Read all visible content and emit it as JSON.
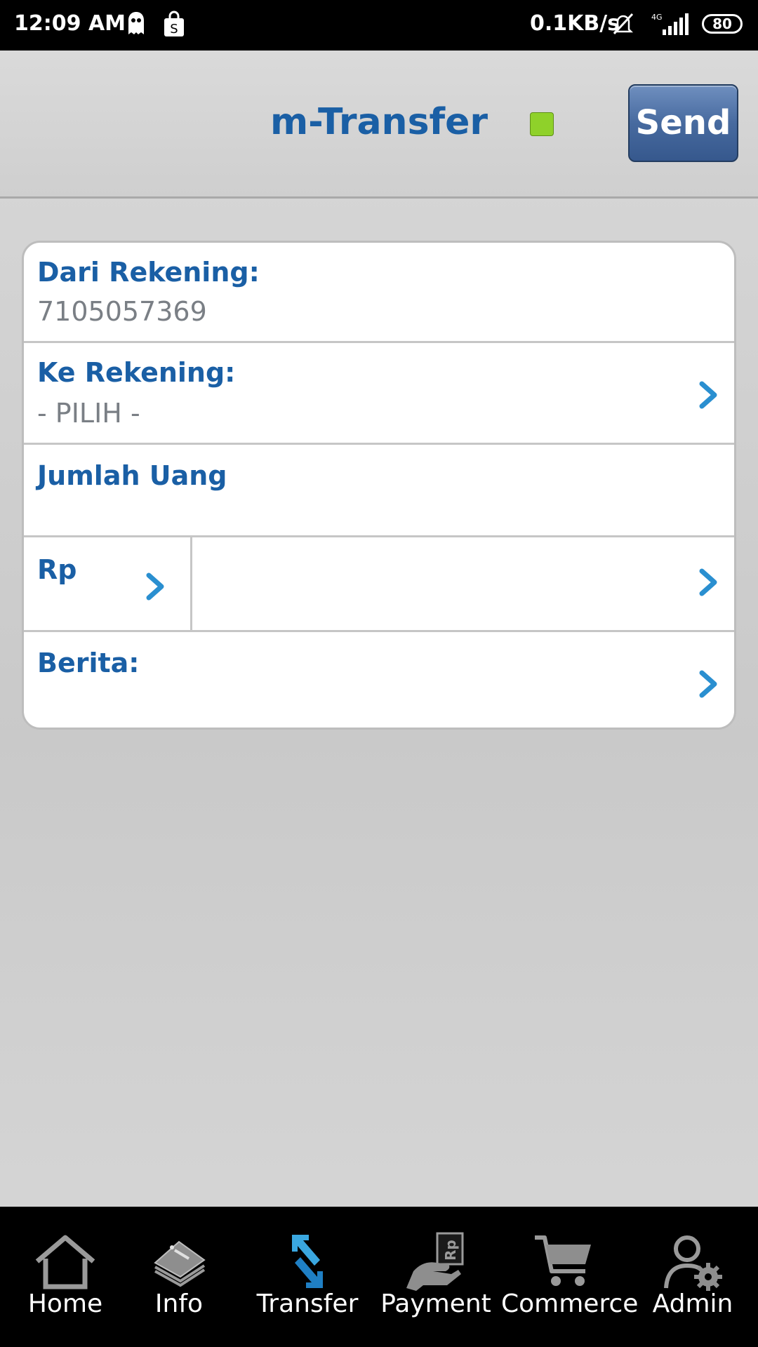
{
  "status_bar": {
    "time": "12:09 AM",
    "net_speed": "0.1KB/s",
    "network": "4G",
    "battery": "80",
    "icons": [
      "ghost-notification-icon",
      "shopping-bag-icon",
      "mute-icon",
      "signal-icon",
      "battery-icon"
    ]
  },
  "header": {
    "title": "m-Transfer",
    "status_color": "#8fd12a",
    "send_label": "Send"
  },
  "form": {
    "from_label": "Dari Rekening:",
    "from_value": "7105057369",
    "to_label": "Ke Rekening:",
    "to_value": "- PILIH -",
    "amount_label": "Jumlah Uang",
    "currency_label": "Rp",
    "amount_value": "",
    "message_label": "Berita:",
    "message_value": ""
  },
  "colors": {
    "accent": "#1a5fa5",
    "chevron": "#2a8fd0"
  },
  "nav": {
    "items": [
      {
        "label": "Home",
        "icon": "home-icon"
      },
      {
        "label": "Info",
        "icon": "info-icon"
      },
      {
        "label": "Transfer",
        "icon": "transfer-icon",
        "active": true
      },
      {
        "label": "Payment",
        "icon": "payment-icon"
      },
      {
        "label": "Commerce",
        "icon": "cart-icon"
      },
      {
        "label": "Admin",
        "icon": "admin-icon"
      }
    ]
  }
}
